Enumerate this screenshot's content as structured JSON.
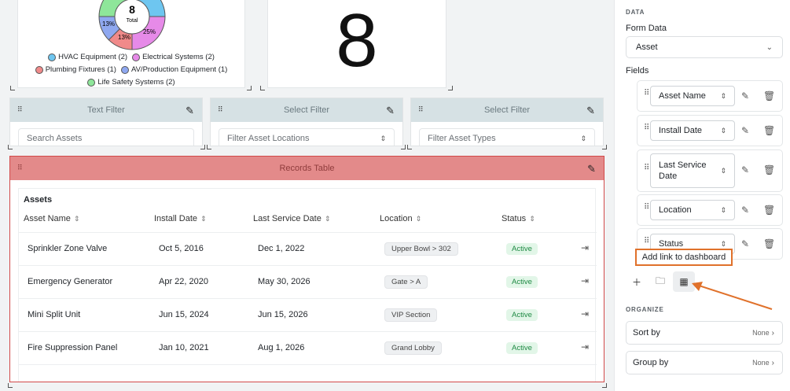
{
  "donut": {
    "center_value": "8",
    "center_label": "Total",
    "slice_labels": [
      "13%",
      "13%",
      "25%"
    ],
    "legend": [
      {
        "label": "HVAC Equipment (2)",
        "color": "#6ec6f0"
      },
      {
        "label": "Electrical Systems (2)",
        "color": "#e68ae8"
      },
      {
        "label": "Plumbing Fixtures (1)",
        "color": "#f08a8a"
      },
      {
        "label": "AV/Production Equipment (1)",
        "color": "#8fa8f0"
      },
      {
        "label": "Life Safety Systems (2)",
        "color": "#8ee69a"
      }
    ]
  },
  "metric": {
    "value": "8"
  },
  "filters": [
    {
      "title": "Text Filter",
      "placeholder": "Search Assets"
    },
    {
      "title": "Select Filter",
      "placeholder": "Filter Asset Locations"
    },
    {
      "title": "Select Filter",
      "placeholder": "Filter Asset Types"
    }
  ],
  "records": {
    "header": "Records Table",
    "table_title": "Assets",
    "columns": [
      "Asset Name",
      "Install Date",
      "Last Service Date",
      "Location",
      "Status"
    ],
    "rows": [
      {
        "name": "Sprinkler Zone Valve",
        "install": "Oct 5, 2016",
        "service": "Dec 1, 2022",
        "location": "Upper Bowl > 302",
        "status": "Active"
      },
      {
        "name": "Emergency Generator",
        "install": "Apr 22, 2020",
        "service": "May 30, 2026",
        "location": "Gate > A",
        "status": "Active"
      },
      {
        "name": "Mini Split Unit",
        "install": "Jun 15, 2024",
        "service": "Jun 15, 2026",
        "location": "VIP Section",
        "status": "Active"
      },
      {
        "name": "Fire Suppression Panel",
        "install": "Jan 10, 2021",
        "service": "Aug 1, 2026",
        "location": "Grand Lobby",
        "status": "Active"
      }
    ]
  },
  "panel": {
    "data_label": "DATA",
    "form_data_label": "Form Data",
    "form_data_value": "Asset",
    "fields_label": "Fields",
    "fields": [
      "Asset Name",
      "Install Date",
      "Last Service Date",
      "Location",
      "Status"
    ],
    "tooltip": "Add link to dashboard",
    "organize_label": "ORGANIZE",
    "sort_by_label": "Sort by",
    "sort_by_value": "None",
    "group_by_label": "Group by",
    "group_by_value": "None"
  },
  "colors": {
    "accent": "#e0712b",
    "records_border": "#d24a4a",
    "status_active": "#1f8a44"
  }
}
